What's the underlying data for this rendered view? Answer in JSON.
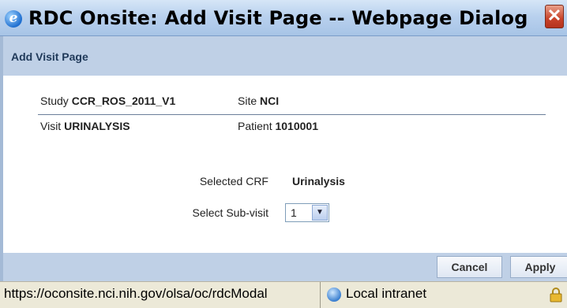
{
  "window": {
    "title": "RDC Onsite: Add Visit Page -- Webpage Dialog",
    "close_glyph": "✕"
  },
  "dialog": {
    "header": "Add Visit Page"
  },
  "info": {
    "study_label": "Study",
    "study_value": "CCR_ROS_2011_V1",
    "site_label": "Site",
    "site_value": "NCI",
    "visit_label": "Visit",
    "visit_value": "URINALYSIS",
    "patient_label": "Patient",
    "patient_value": "1010001"
  },
  "form": {
    "selected_crf_label": "Selected CRF",
    "selected_crf_value": "Urinalysis",
    "sub_visit_label": "Select Sub-visit",
    "sub_visit_value": "1"
  },
  "buttons": {
    "cancel": "Cancel",
    "apply": "Apply"
  },
  "status": {
    "url": "https://oconsite.nci.nih.gov/olsa/oc/rdcModal",
    "zone": "Local intranet",
    "zone_icon": "globe-icon",
    "lock_icon": "lock-icon"
  }
}
